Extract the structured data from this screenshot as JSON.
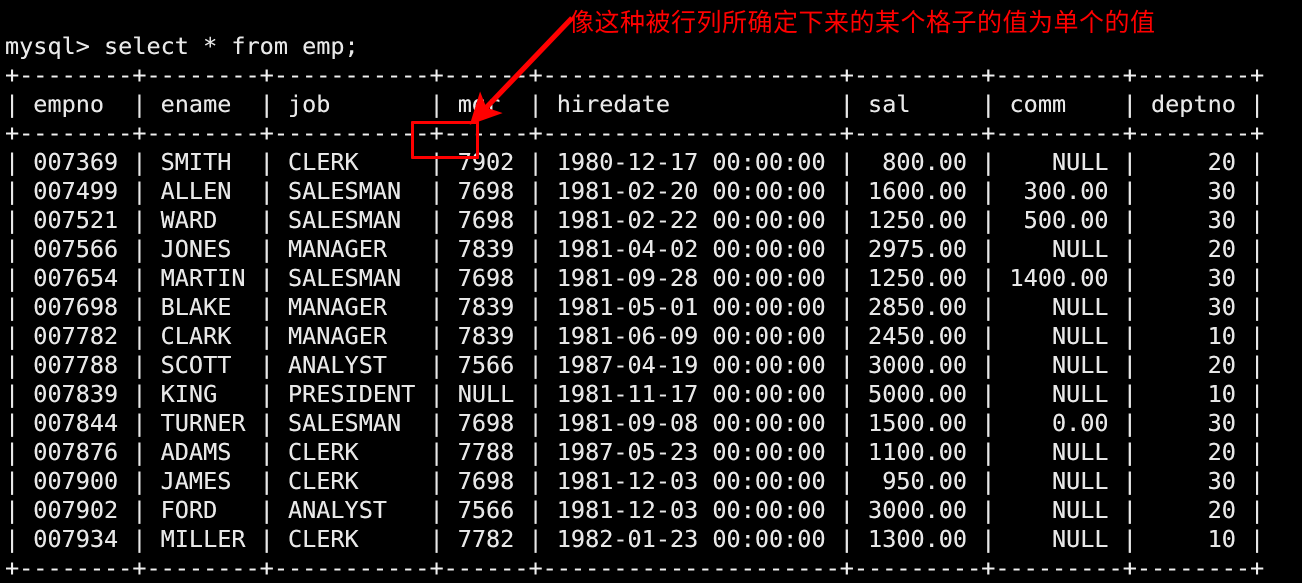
{
  "terminal": {
    "prompt_line": "mysql> select * from emp;",
    "border_top": "+---------+--------+-----------+------+---------------------+---------+---------+--------+",
    "header_row": "| empno   | ename  | job       | mgr  | hiredate            | sal     | comm    | deptno |",
    "border_header": "+---------+--------+-----------+------+---------------------+---------+---------+--------+",
    "border_bottom": "+---------+--------+-----------+------+---------------------+---------+---------+--------+",
    "columns": [
      "empno",
      "ename",
      "job",
      "mgr",
      "hiredate",
      "sal",
      "comm",
      "deptno"
    ],
    "rows": [
      [
        "007369",
        "SMITH",
        "CLERK",
        "7902",
        "1980-12-17 00:00:00",
        "800.00",
        "NULL",
        "20"
      ],
      [
        "007499",
        "ALLEN",
        "SALESMAN",
        "7698",
        "1981-02-20 00:00:00",
        "1600.00",
        "300.00",
        "30"
      ],
      [
        "007521",
        "WARD",
        "SALESMAN",
        "7698",
        "1981-02-22 00:00:00",
        "1250.00",
        "500.00",
        "30"
      ],
      [
        "007566",
        "JONES",
        "MANAGER",
        "7839",
        "1981-04-02 00:00:00",
        "2975.00",
        "NULL",
        "20"
      ],
      [
        "007654",
        "MARTIN",
        "SALESMAN",
        "7698",
        "1981-09-28 00:00:00",
        "1250.00",
        "1400.00",
        "30"
      ],
      [
        "007698",
        "BLAKE",
        "MANAGER",
        "7839",
        "1981-05-01 00:00:00",
        "2850.00",
        "NULL",
        "30"
      ],
      [
        "007782",
        "CLARK",
        "MANAGER",
        "7839",
        "1981-06-09 00:00:00",
        "2450.00",
        "NULL",
        "10"
      ],
      [
        "007788",
        "SCOTT",
        "ANALYST",
        "7566",
        "1987-04-19 00:00:00",
        "3000.00",
        "NULL",
        "20"
      ],
      [
        "007839",
        "KING",
        "PRESIDENT",
        "NULL",
        "1981-11-17 00:00:00",
        "5000.00",
        "NULL",
        "10"
      ],
      [
        "007844",
        "TURNER",
        "SALESMAN",
        "7698",
        "1981-09-08 00:00:00",
        "1500.00",
        "0.00",
        "30"
      ],
      [
        "007876",
        "ADAMS",
        "CLERK",
        "7788",
        "1987-05-23 00:00:00",
        "1100.00",
        "NULL",
        "20"
      ],
      [
        "007900",
        "JAMES",
        "CLERK",
        "7698",
        "1981-12-03 00:00:00",
        "950.00",
        "NULL",
        "30"
      ],
      [
        "007902",
        "FORD",
        "ANALYST",
        "7566",
        "1981-12-03 00:00:00",
        "3000.00",
        "NULL",
        "20"
      ],
      [
        "007934",
        "MILLER",
        "CLERK",
        "7782",
        "1982-01-23 00:00:00",
        "1300.00",
        "NULL",
        "10"
      ]
    ]
  },
  "annotation": {
    "note": "像这种被行列所确定下来的某个格子的值为单个的值",
    "highlighted_cell_value": "7902",
    "highlighted_cell_column": "mgr",
    "highlighted_cell_row": "007369",
    "color": "#ff0000"
  },
  "colors": {
    "background": "#000000",
    "text": "#e8e8e8",
    "annotation": "#ff0000"
  }
}
